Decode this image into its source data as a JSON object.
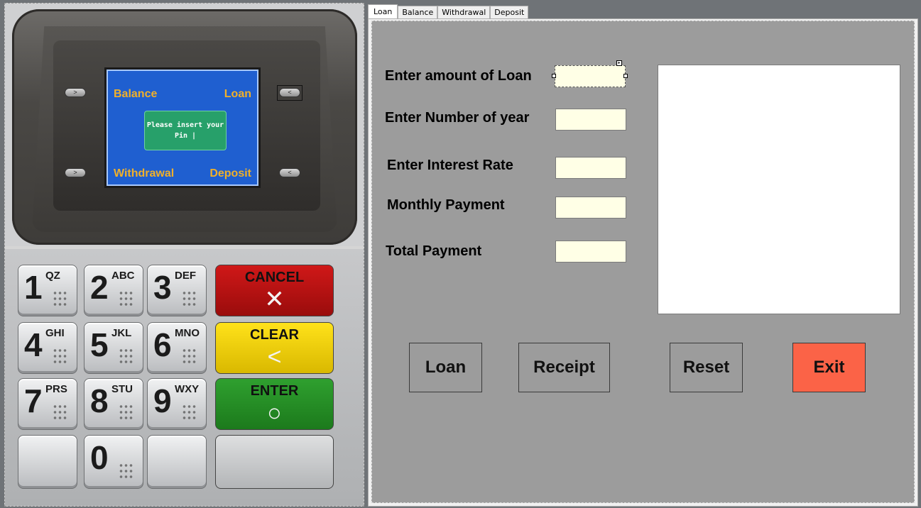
{
  "atm": {
    "screen": {
      "balance_label": "Balance",
      "loan_label": "Loan",
      "withdrawal_label": "Withdrawal",
      "deposit_label": "Deposit",
      "prompt": "Please insert your Pin"
    },
    "side_keys": {
      "left_symbol": ">",
      "right_symbol": "<"
    },
    "keypad": {
      "keys": [
        {
          "digit": "1",
          "letters": "QZ"
        },
        {
          "digit": "2",
          "letters": "ABC"
        },
        {
          "digit": "3",
          "letters": "DEF"
        },
        {
          "digit": "4",
          "letters": "GHI"
        },
        {
          "digit": "5",
          "letters": "JKL"
        },
        {
          "digit": "6",
          "letters": "MNO"
        },
        {
          "digit": "7",
          "letters": "PRS"
        },
        {
          "digit": "8",
          "letters": "STU"
        },
        {
          "digit": "9",
          "letters": "WXY"
        },
        {
          "digit": "0",
          "letters": ""
        }
      ],
      "cancel_label": "CANCEL",
      "clear_label": "CLEAR",
      "enter_label": "ENTER"
    }
  },
  "tabs": [
    "Loan",
    "Balance",
    "Withdrawal",
    "Deposit"
  ],
  "active_tab": "Loan",
  "form": {
    "loan_amount_label": "Enter amount of Loan",
    "years_label": "Enter Number of year",
    "interest_label": "Enter Interest Rate",
    "monthly_label": "Monthly Payment",
    "total_label": "Total Payment",
    "loan_amount_value": "",
    "years_value": "",
    "interest_value": "",
    "monthly_value": "",
    "total_value": "",
    "receipt_text": ""
  },
  "buttons": {
    "loan": "Loan",
    "receipt": "Receipt",
    "reset": "Reset",
    "exit": "Exit"
  },
  "colors": {
    "exit_button": "#fb6347",
    "input_background": "#ffffe6",
    "form_background": "#9c9c9c",
    "atm_screen": "#1f5fd0"
  }
}
